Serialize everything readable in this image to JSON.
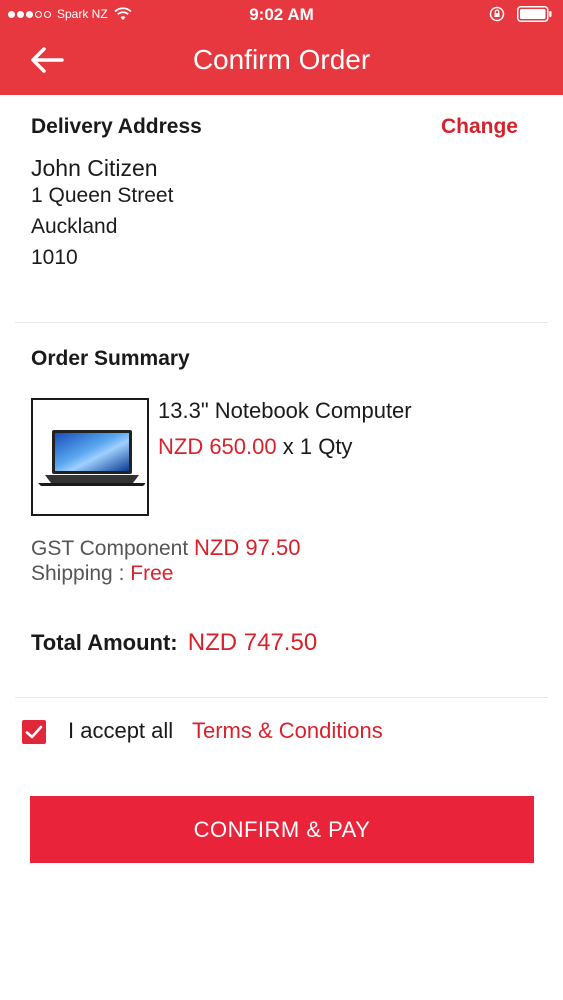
{
  "status_bar": {
    "carrier": "Spark NZ",
    "time": "9:02 AM",
    "icons": [
      "signal-icon",
      "wifi-icon",
      "rotation-lock-icon",
      "battery-icon"
    ]
  },
  "header": {
    "title": "Confirm Order",
    "back_icon": "arrow-left-icon"
  },
  "delivery": {
    "title": "Delivery Address",
    "change_label": "Change",
    "name": "John Citizen",
    "street": "1 Queen Street",
    "city": "Auckland",
    "postcode": "1010"
  },
  "order": {
    "title": "Order Summary",
    "product_name": "13.3\" Notebook Computer",
    "price": "NZD 650.00",
    "qty": "x 1 Qty",
    "gst_label": "GST Component",
    "gst_value": "NZD 97.50",
    "shipping_label": "Shipping :",
    "shipping_value": "Free",
    "total_label": "Total Amount:",
    "total_value": "NZD 747.50"
  },
  "terms": {
    "checked": true,
    "text": "I accept all",
    "link": "Terms & Conditions"
  },
  "pay_button": "CONFIRM & PAY",
  "colors": {
    "header_red": "#e8383f",
    "accent_red": "#d8222b",
    "button_red": "#e8233a"
  }
}
